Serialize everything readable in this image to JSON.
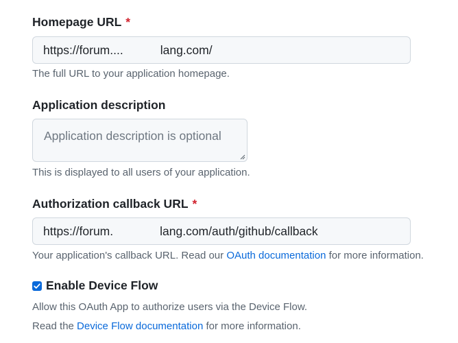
{
  "homepage": {
    "label": "Homepage URL",
    "required_mark": "*",
    "value_prefix": "https://forum.",
    "value_ellipsis": "...",
    "value_suffix": "lang.com/",
    "help": "The full URL to your application homepage."
  },
  "description": {
    "label": "Application description",
    "placeholder": "Application description is optional",
    "help": "This is displayed to all users of your application."
  },
  "callback": {
    "label": "Authorization callback URL",
    "required_mark": "*",
    "value_prefix": "https://forum.",
    "value_suffix": "lang.com/auth/github/callback",
    "help_before": "Your application's callback URL. Read our ",
    "help_link": "OAuth documentation",
    "help_after": " for more information."
  },
  "device_flow": {
    "checked": true,
    "label": "Enable Device Flow",
    "help": "Allow this OAuth App to authorize users via the Device Flow.",
    "docs_before": "Read the ",
    "docs_link": "Device Flow documentation",
    "docs_after": " for more information."
  },
  "colors": {
    "accent": "#0969da",
    "required": "#d1242f",
    "muted": "#59636e",
    "input_bg": "#f6f8fa",
    "border": "#d0d7de"
  }
}
